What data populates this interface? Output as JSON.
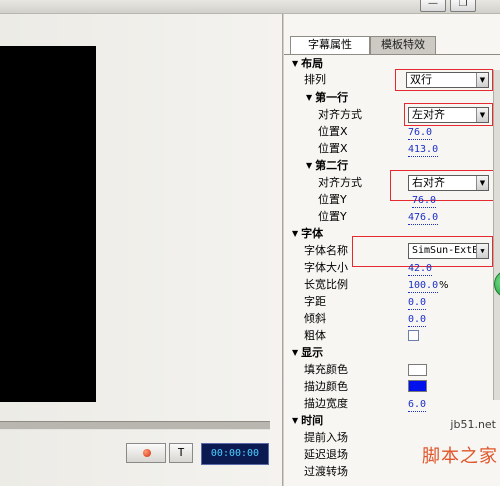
{
  "tabs": {
    "active": "字幕属性",
    "inactive": "模板特效"
  },
  "layout_section": {
    "title": "布局",
    "arrangement_label": "排列",
    "arrangement_value": "双行",
    "line1": {
      "title": "第一行",
      "align_label": "对齐方式",
      "align_value": "左对齐",
      "pos_x_label": "位置X",
      "pos_x_value": "76.0",
      "pos_y_label": "位置X",
      "pos_y_value": "413.0"
    },
    "line2": {
      "title": "第二行",
      "align_label": "对齐方式",
      "align_value": "右对齐",
      "pos_x_label": "位置Y",
      "pos_x_value": "76.0",
      "pos_y_label": "位置Y",
      "pos_y_value": "476.0"
    }
  },
  "font_section": {
    "title": "字体",
    "name_label": "字体名称",
    "name_value": "SimSun-ExtB",
    "size_label": "字体大小",
    "size_value": "42.0",
    "ratio_label": "长宽比例",
    "ratio_value": "100.0",
    "ratio_unit": "%",
    "spacing_label": "字距",
    "spacing_value": "0.0",
    "skew_label": "倾斜",
    "skew_value": "0.0",
    "bold_label": "粗体",
    "bold_checked": false
  },
  "display_section": {
    "title": "显示",
    "fill_label": "填充颜色",
    "fill_color": "#ffffff",
    "stroke_label": "描边颜色",
    "stroke_color": "#0011ee",
    "stroke_width_label": "描边宽度",
    "stroke_width_value": "6.0"
  },
  "time_section": {
    "title": "时间",
    "enter_label": "提前入场",
    "exit_label": "延迟退场",
    "transition_label": "过渡转场"
  },
  "player": {
    "timecode": "00:00:00",
    "t_label": "T"
  },
  "window": {
    "minimize_glyph": "—",
    "restore_glyph": "❐"
  },
  "watermark": {
    "url": "jb51.net",
    "text": "脚本之家"
  },
  "colors": {
    "highlight": "#e6292e",
    "value_link": "#1c2fc8",
    "timecode_bg": "#0c1a52"
  }
}
